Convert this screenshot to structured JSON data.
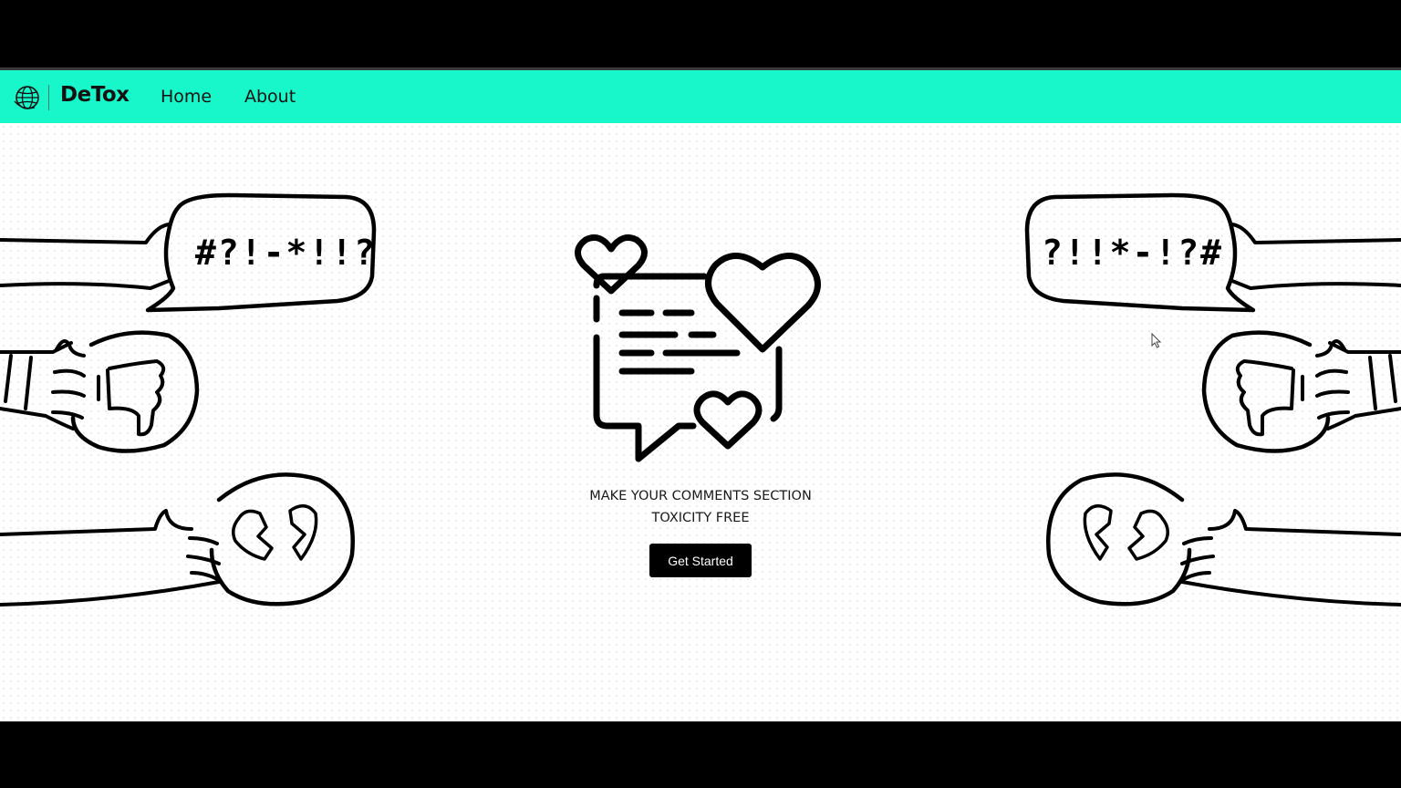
{
  "app": {
    "brand": "DeTox",
    "logo_icon": "globe-icon"
  },
  "nav": {
    "items": [
      {
        "label": "Home"
      },
      {
        "label": "About"
      }
    ]
  },
  "hero": {
    "headline_line1": "MAKE YOUR COMMENTS SECTION",
    "headline_line2": "TOXICITY FREE",
    "cta_label": "Get Started",
    "center_icon": "chat-bubble-hearts-icon",
    "left_bubble_text": "#?!-*!!?",
    "right_bubble_text": "?!!*-!?#"
  },
  "colors": {
    "navbar": "#17f7c9",
    "cta_bg": "#000000",
    "cta_text": "#ffffff"
  }
}
